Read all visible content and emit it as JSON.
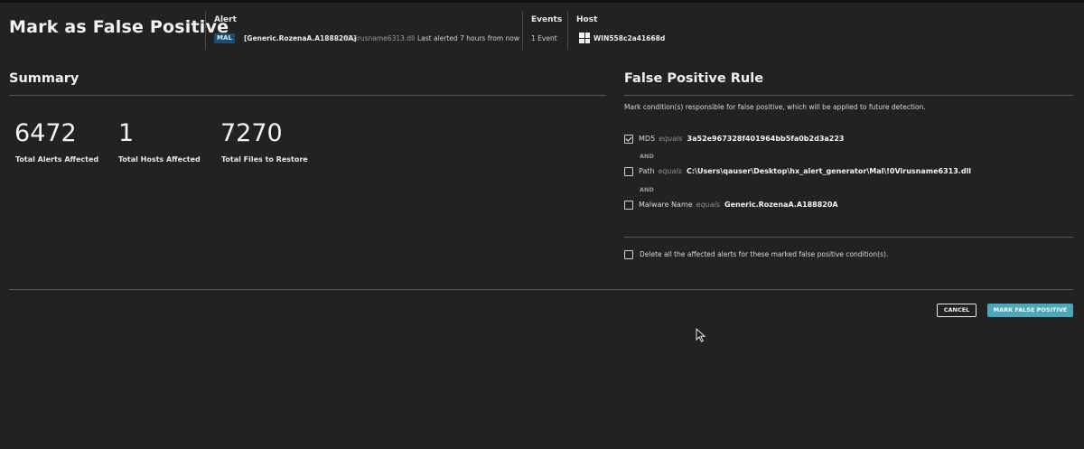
{
  "header": {
    "title": "Mark as False Positive",
    "alert": {
      "label": "Alert",
      "badge": "MAL",
      "name": "[Generic.RozenaA.A188820A]",
      "file": "!0Virusname6313.dll",
      "last_alerted": "Last alerted 7 hours from now"
    },
    "events": {
      "label": "Events",
      "value": "1 Event"
    },
    "host": {
      "label": "Host",
      "icon": "windows-icon",
      "name": "WIN558c2a41668d"
    }
  },
  "summary": {
    "title": "Summary",
    "stats": [
      {
        "value": "6472",
        "label": "Total Alerts Affected"
      },
      {
        "value": "1",
        "label": "Total Hosts Affected"
      },
      {
        "value": "7270",
        "label": "Total Files to Restore"
      }
    ]
  },
  "rule": {
    "title": "False Positive Rule",
    "description": "Mark condition(s) responsible for false positive, which will be applied to future detection.",
    "conditions": [
      {
        "field": "MD5",
        "operator": "equals",
        "value": "3a52e967328f401964bb5fa0b2d3a223",
        "checked": true
      },
      {
        "field": "Path",
        "operator": "equals",
        "value": "C:\\Users\\qauser\\Desktop\\hx_alert_generator\\Mal\\!0Virusname6313.dll",
        "checked": false
      },
      {
        "field": "Malware Name",
        "operator": "equals",
        "value": "Generic.RozenaA.A188820A",
        "checked": false
      }
    ],
    "joiner": "AND",
    "delete_option": {
      "label": "Delete all the affected alerts for these marked false positive condition(s).",
      "checked": false
    }
  },
  "actions": {
    "cancel": "CANCEL",
    "submit": "MARK FALSE POSITIVE"
  },
  "colors": {
    "background": "#222223",
    "badge": "#1d4e73",
    "primary_button": "#4aa8ba"
  }
}
